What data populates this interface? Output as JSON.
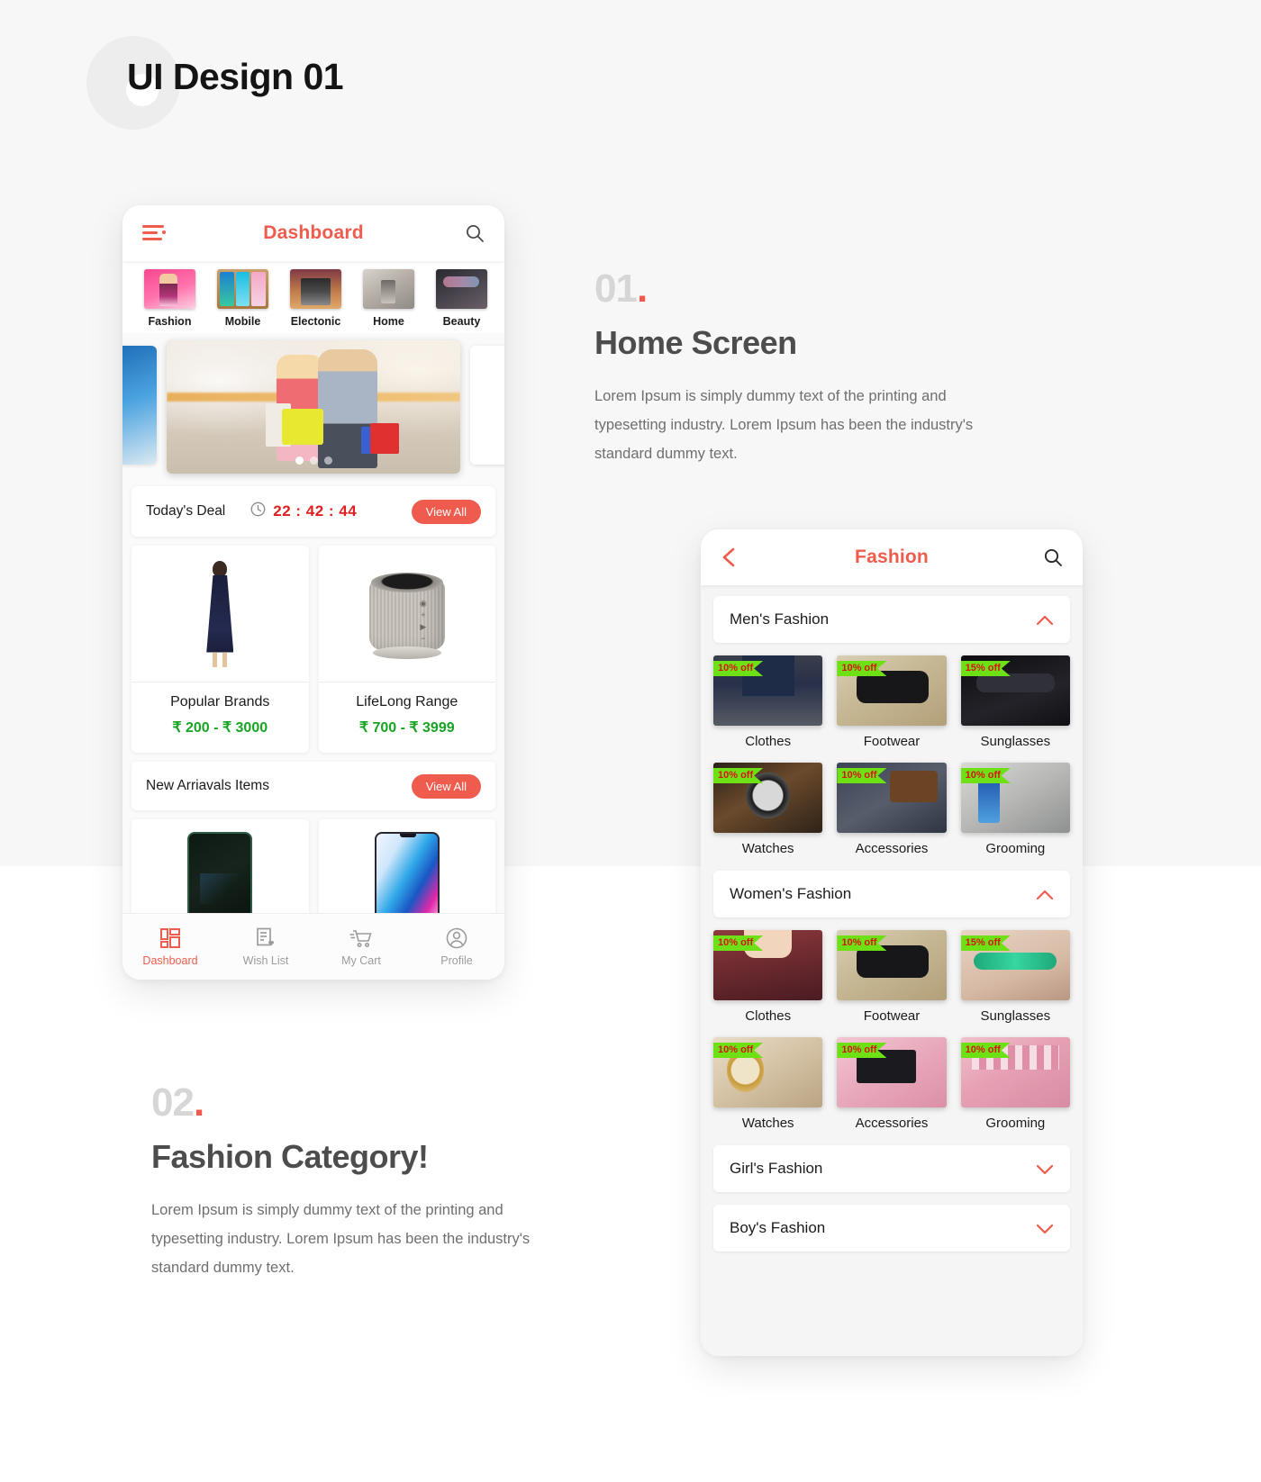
{
  "masthead": {
    "title": "UI Design 01"
  },
  "home_screen": {
    "header": {
      "title": "Dashboard",
      "menu_icon": "hamburger-icon",
      "search_icon": "search-icon"
    },
    "categories": [
      {
        "label": "Fashion",
        "thumb": "t-fashion"
      },
      {
        "label": "Mobile",
        "thumb": "t-mobile"
      },
      {
        "label": "Electonic",
        "thumb": "t-electronic"
      },
      {
        "label": "Home",
        "thumb": "t-home"
      },
      {
        "label": "Beauty",
        "thumb": "t-beauty"
      }
    ],
    "deal": {
      "title": "Today's Deal",
      "timer": "22 : 42 : 44",
      "clock_icon": "clock-icon",
      "view_all": "View All"
    },
    "products": [
      {
        "name": "Popular Brands",
        "price": "₹ 200  -  ₹ 3000"
      },
      {
        "name": "LifeLong Range",
        "price": "₹ 700  -  ₹ 3999"
      }
    ],
    "new_arrivals": {
      "title": "New Arriavals Items",
      "view_all": "View All"
    },
    "bottom_nav": [
      {
        "label": "Dashboard",
        "icon": "dashboard-icon",
        "active": true
      },
      {
        "label": "Wish List",
        "icon": "wishlist-icon",
        "active": false
      },
      {
        "label": "My Cart",
        "icon": "cart-icon",
        "active": false
      },
      {
        "label": "Profile",
        "icon": "profile-icon",
        "active": false
      }
    ]
  },
  "category_screen": {
    "header": {
      "title": "Fashion",
      "back_icon": "back-chevron-icon",
      "search_icon": "search-icon"
    },
    "sections": [
      {
        "label": "Men's Fashion",
        "expanded": true,
        "chevron": "chevron-up-icon"
      },
      {
        "label": "Women's Fashion",
        "expanded": true,
        "chevron": "chevron-up-icon"
      },
      {
        "label": "Girl's Fashion",
        "expanded": false,
        "chevron": "chevron-down-icon"
      },
      {
        "label": "Boy's Fashion",
        "expanded": false,
        "chevron": "chevron-down-icon"
      }
    ],
    "mens_tiles": [
      {
        "label": "Clothes",
        "badge": "10% off",
        "art": "im-shirt-m"
      },
      {
        "label": "Footwear",
        "badge": "10% off",
        "art": "im-sandal-m"
      },
      {
        "label": "Sunglasses",
        "badge": "15% off",
        "art": "im-sun-m"
      },
      {
        "label": "Watches",
        "badge": "10% off",
        "art": "im-watch-m"
      },
      {
        "label": "Accessories",
        "badge": "10% off",
        "art": "im-acc-m"
      },
      {
        "label": "Grooming",
        "badge": "10% off",
        "art": "im-groom-m"
      }
    ],
    "womens_tiles": [
      {
        "label": "Clothes",
        "badge": "10% off",
        "art": "im-shirt-w"
      },
      {
        "label": "Footwear",
        "badge": "10% off",
        "art": "im-sandal-w"
      },
      {
        "label": "Sunglasses",
        "badge": "15% off",
        "art": "im-sun-w"
      },
      {
        "label": "Watches",
        "badge": "10% off",
        "art": "im-watch-w"
      },
      {
        "label": "Accessories",
        "badge": "10% off",
        "art": "im-acc-w"
      },
      {
        "label": "Grooming",
        "badge": "10% off",
        "art": "im-groom-w"
      }
    ]
  },
  "annotations": [
    {
      "number": "01",
      "dot": ".",
      "heading": "Home Screen",
      "text": "Lorem Ipsum is simply dummy text of the printing and typesetting industry. Lorem Ipsum has been the industry's standard dummy text."
    },
    {
      "number": "02",
      "dot": ".",
      "heading": "Fashion Category!",
      "text": "Lorem Ipsum is simply dummy text of the printing and typesetting industry. Lorem Ipsum has been the industry's standard dummy text."
    }
  ],
  "colors": {
    "accent": "#ef5b4c",
    "price_green": "#16a422",
    "timer_red": "#e02020",
    "badge_green": "#6ee016"
  }
}
